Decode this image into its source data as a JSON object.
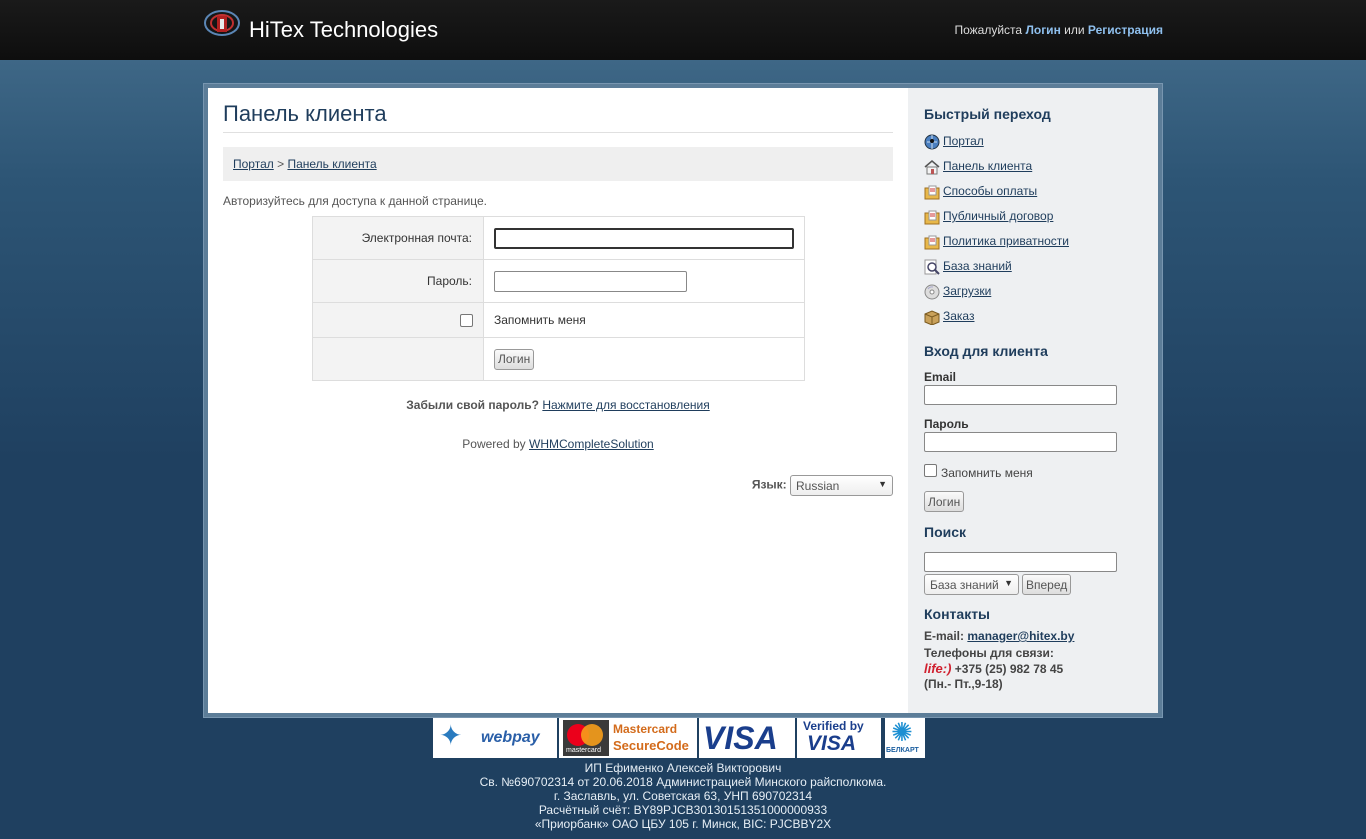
{
  "header": {
    "site_title": "HiTex Technologies",
    "login_prompt_prefix": "Пожалуйста",
    "login_link": "Логин",
    "login_prompt_or": "или",
    "register_link": "Регистрация"
  },
  "main": {
    "page_title": "Панель клиента",
    "breadcrumb": {
      "home": "Портал",
      "separator": ">",
      "current": "Панель клиента"
    },
    "auth_notice": "Авторизуйтесь для доступа к данной странице.",
    "form": {
      "email_label": "Электронная почта:",
      "email_value": "",
      "password_label": "Пароль:",
      "password_value": "",
      "remember_label": "Запомнить меня",
      "remember_checked": false,
      "submit_label": "Логин"
    },
    "forgot_text": "Забыли свой пароль?",
    "forgot_link": "Нажмите для восстановления",
    "powered_by": "Powered by",
    "powered_link": "WHMCompleteSolution",
    "language_label": "Язык:",
    "language_value": "Russian"
  },
  "sidebar": {
    "quicknav_title": "Быстрый переход",
    "quicknav": [
      {
        "label": "Портал",
        "icon": "globe-icon"
      },
      {
        "label": "Панель клиента",
        "icon": "home-icon"
      },
      {
        "label": "Способы оплаты",
        "icon": "folder-doc-icon"
      },
      {
        "label": "Публичный договор",
        "icon": "folder-doc-icon"
      },
      {
        "label": "Политика приватности",
        "icon": "folder-doc-icon"
      },
      {
        "label": "База знаний",
        "icon": "magnifier-doc-icon"
      },
      {
        "label": "Загрузки",
        "icon": "disc-icon"
      },
      {
        "label": "Заказ",
        "icon": "package-icon"
      }
    ],
    "login_title": "Вход для клиента",
    "email_label": "Email",
    "password_label": "Пароль",
    "remember_label": "Запомнить меня",
    "submit_label": "Логин",
    "search_title": "Поиск",
    "search_value": "",
    "search_scope": "База знаний",
    "search_button": "Вперед",
    "contacts_title": "Контакты",
    "email_prefix": "E-mail:",
    "email": "manager@hitex.by",
    "phones_label": "Телефоны для связи:",
    "operator": "life:)",
    "phone": "+375 (25) 982 78 45",
    "hours": "(Пн.- Пт.,9-18)"
  },
  "payments": {
    "webpay": "webpay",
    "mastercard": "mastercard",
    "securecode_1": "Mastercard",
    "securecode_2": "SecureCode",
    "visa": "VISA",
    "verified_1": "Verified by",
    "verified_2": "VISA",
    "belkart": "БЕЛКАРТ"
  },
  "footer": {
    "line1": "ИП Ефименко Алексей Викторович",
    "line2": "Св. №690702314 от 20.06.2018 Администрацией Минского райсполкома.",
    "line3": "г. Заславль, ул. Советская 63, УНП 690702314",
    "line4": "Расчётный счёт: BY89PJCB30130151351000000933",
    "line5": "«Приорбанк» ОАО ЦБУ 105 г. Минск, BIC: PJCBBY2X"
  },
  "colors": {
    "link": "#1f3d5c",
    "header_bg": "#111111",
    "frame": "#5c7d98",
    "page_bg": "#1f4060"
  }
}
